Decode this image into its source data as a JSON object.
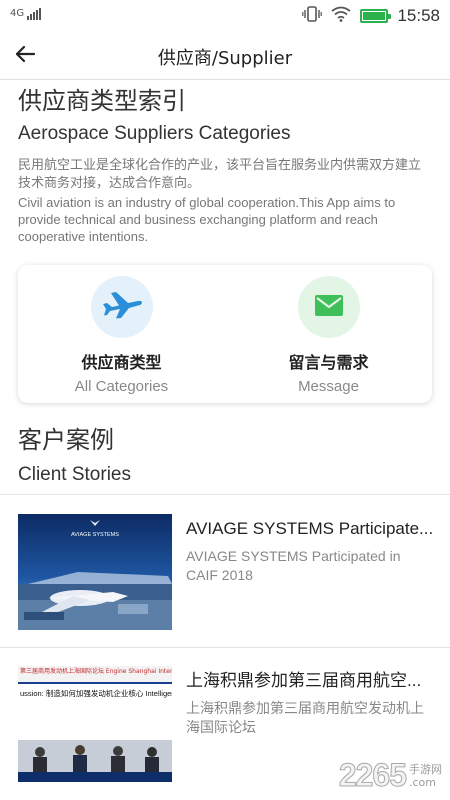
{
  "status_bar": {
    "network": "4G",
    "time": "15:58",
    "battery_level": 1.0
  },
  "app_bar": {
    "title": "供应商/Supplier",
    "back_icon": "arrow-left-icon"
  },
  "intro": {
    "title_zh": "供应商类型索引",
    "title_en": "Aerospace Suppliers Categories",
    "desc_zh": "民用航空工业是全球化合作的产业，该平台旨在服务业内供需双方建立技术商务对接，达成合作意向。",
    "desc_en": "Civil aviation is an industry of global cooperation.This App aims to provide technical and business exchanging platform and reach cooperative intentions."
  },
  "quick_actions": [
    {
      "label_zh": "供应商类型",
      "label_en": "All Categories",
      "icon": "airplane-icon",
      "icon_color": "#2a8fd8",
      "bg_color": "#e4f1fb"
    },
    {
      "label_zh": "留言与需求",
      "label_en": "Message",
      "icon": "envelope-icon",
      "icon_color": "#3fbf5a",
      "bg_color": "#e3f6e6"
    }
  ],
  "client_stories": {
    "title_zh": "客户案例",
    "title_en": "Client Stories",
    "items": [
      {
        "title": "AVIAGE SYSTEMS Participate...",
        "subtitle": "AVIAGE SYSTEMS Participated in CAIF 2018",
        "image_text": "AVIAGE SYSTEMS"
      },
      {
        "title": "上海积鼎参加第三届商用航空...",
        "subtitle": "上海积鼎参加第三届商用航空发动机上海国际论坛",
        "image_text": "ussion: 制造如何加强发动机企业核心 Intelligent Manufacturing Inc eness of Aero Engine Manufa",
        "image_header": "第三届商用发动机上海国际论坛 Engine Shanghai International Forum"
      }
    ]
  },
  "watermark": {
    "number": "2265",
    "text": "手游网",
    "domain": ".com"
  },
  "colors": {
    "accent_blue": "#2a8fd8",
    "accent_green": "#3fbf5a",
    "battery_green": "#2bb24c"
  }
}
